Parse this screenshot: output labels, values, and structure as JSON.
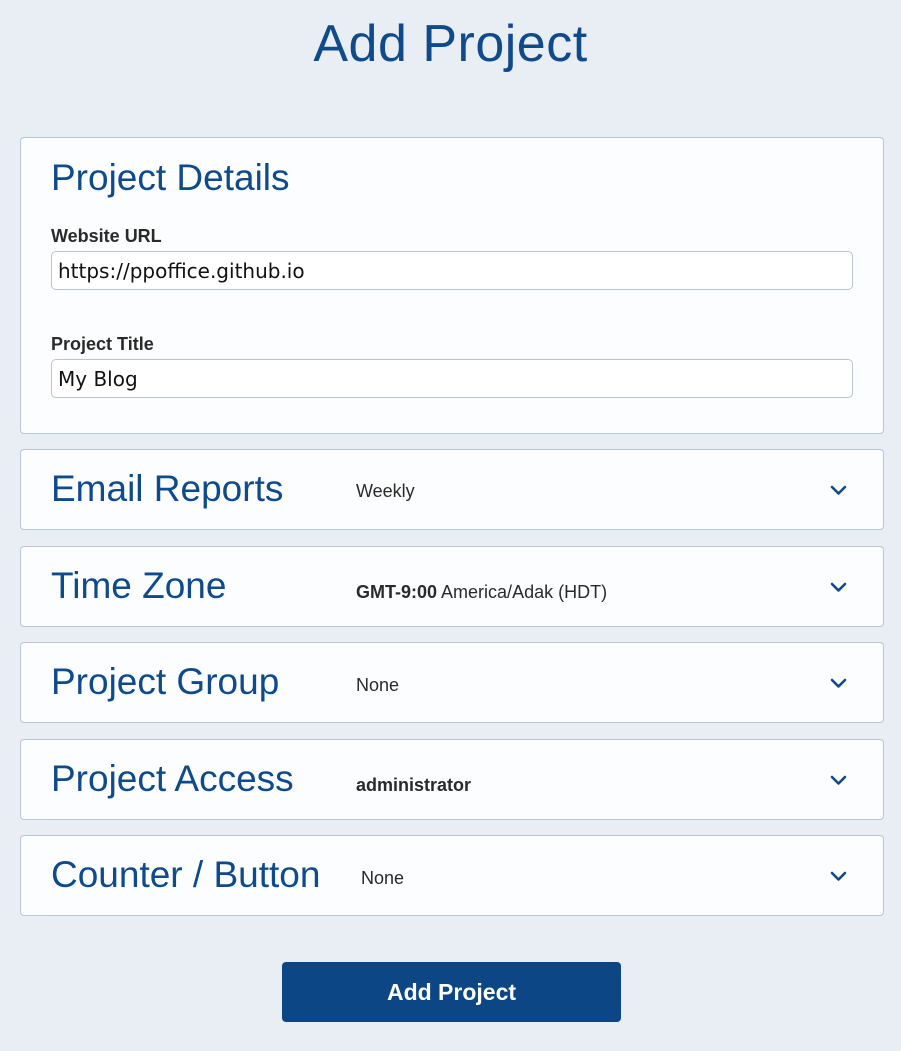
{
  "page": {
    "title": "Add Project"
  },
  "details": {
    "title": "Project Details",
    "website_label": "Website URL",
    "website_value": "https://ppoffice.github.io",
    "project_title_label": "Project Title",
    "project_title_value": "My Blog"
  },
  "sections": [
    {
      "title": "Email Reports",
      "value": "Weekly",
      "icon": "chevron-down-icon"
    },
    {
      "title": "Time Zone",
      "value_bold": "GMT-9:00",
      "value": "America/Adak (HDT)",
      "icon": "chevron-down-icon"
    },
    {
      "title": "Project Group",
      "value": "None",
      "icon": "chevron-down-icon"
    },
    {
      "title": "Project Access",
      "value_bold": "administrator",
      "icon": "chevron-down-icon"
    },
    {
      "title": "Counter / Button",
      "value": "None",
      "icon": "chevron-down-icon"
    }
  ],
  "submit": {
    "label": "Add Project"
  },
  "colors": {
    "accent": "#0f4a8a",
    "button": "#0d4684",
    "background": "#e8eef4"
  }
}
